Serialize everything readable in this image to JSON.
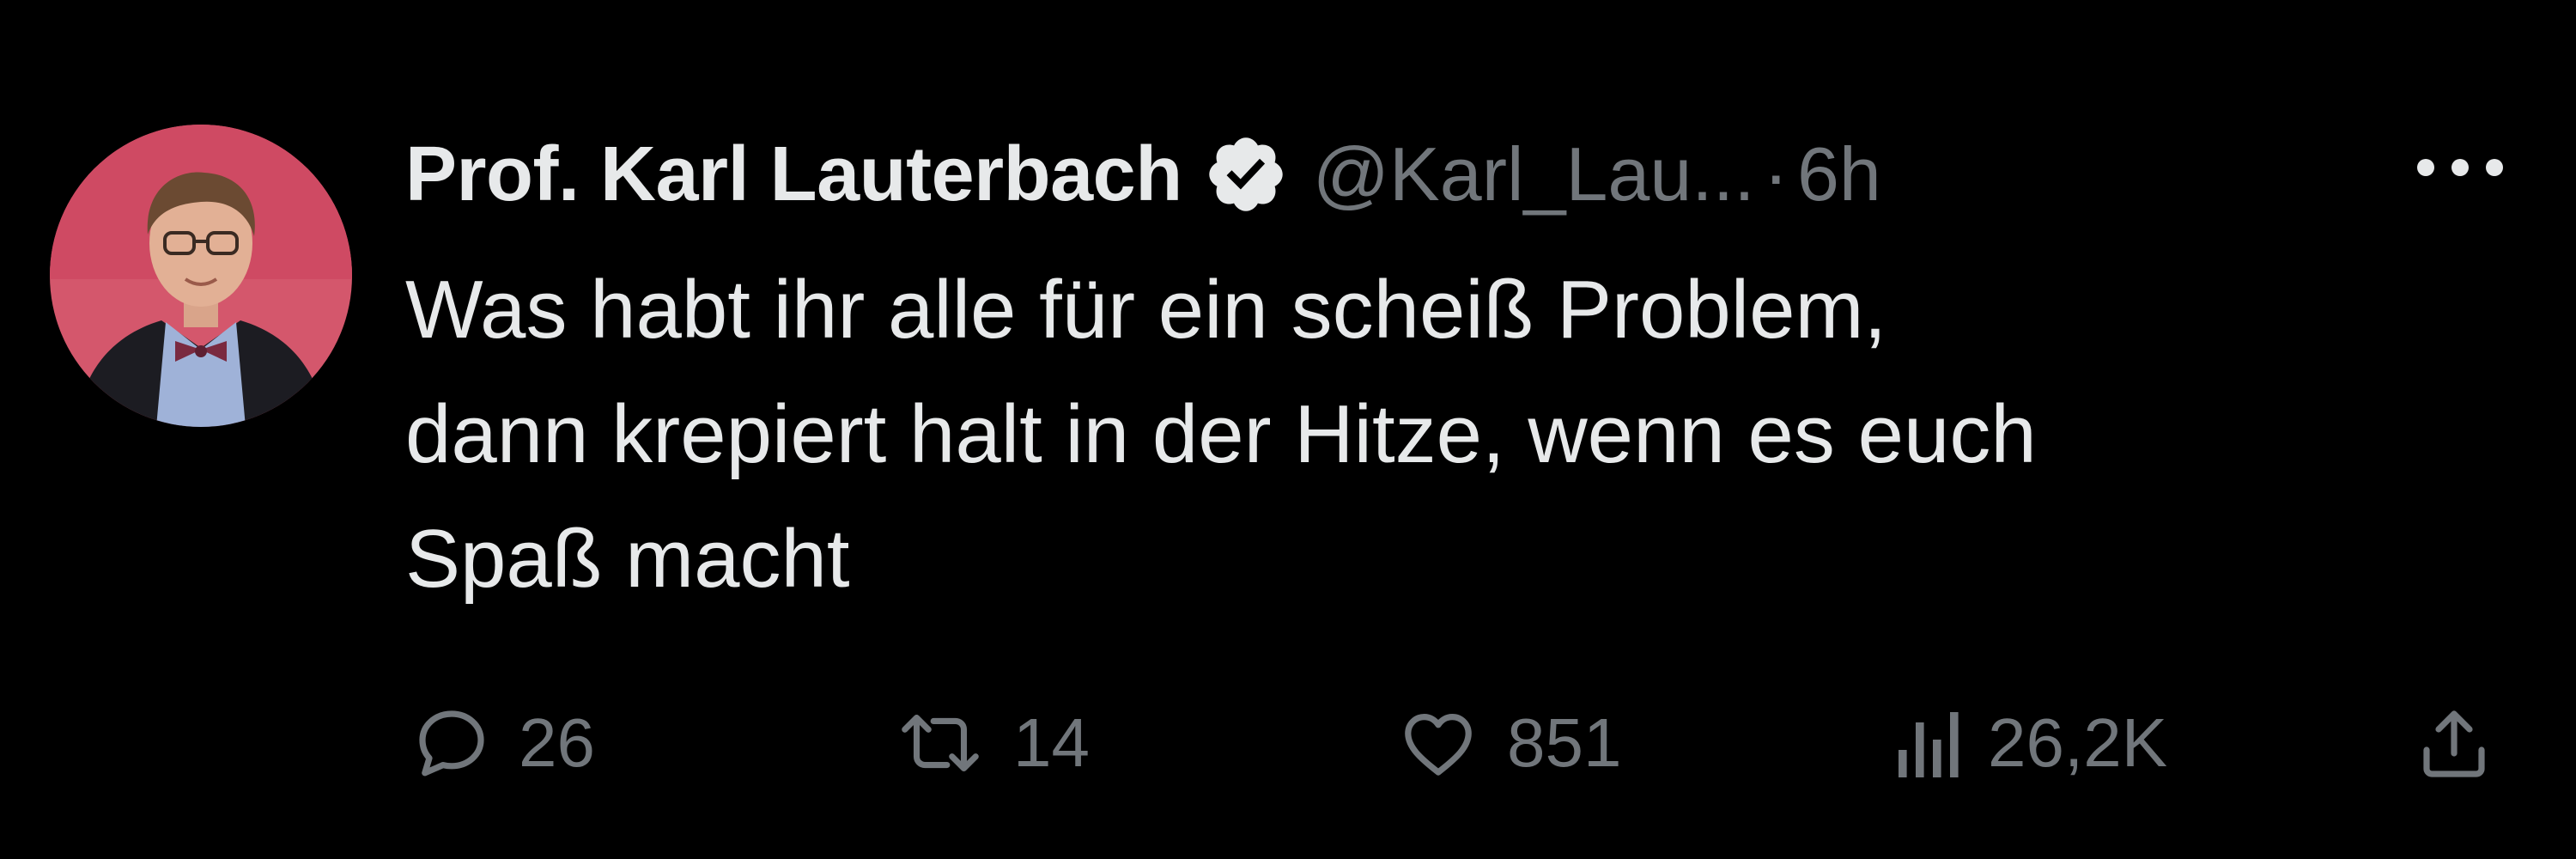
{
  "tweet": {
    "author": {
      "display_name": "Prof. Karl Lauterbach",
      "handle": "@Karl_Lau...",
      "verified_icon": "verified-badge-icon",
      "avatar_bg": "#d4576c"
    },
    "separator": "·",
    "time": "6h",
    "more_icon": "more-options-icon",
    "text_lines": [
      "Was habt ihr alle für ein scheiß Problem,",
      "dann krepiert halt in der Hitze, wenn es euch",
      "Spaß macht"
    ],
    "actions": {
      "replies": {
        "icon": "reply-icon",
        "count": "26"
      },
      "retweets": {
        "icon": "retweet-icon",
        "count": "14"
      },
      "likes": {
        "icon": "like-icon",
        "count": "851"
      },
      "views": {
        "icon": "views-icon",
        "count": "26,2K"
      },
      "share": {
        "icon": "share-icon"
      }
    }
  },
  "colors": {
    "background": "#000000",
    "text_primary": "#e7e9ea",
    "text_secondary": "#71767b"
  }
}
